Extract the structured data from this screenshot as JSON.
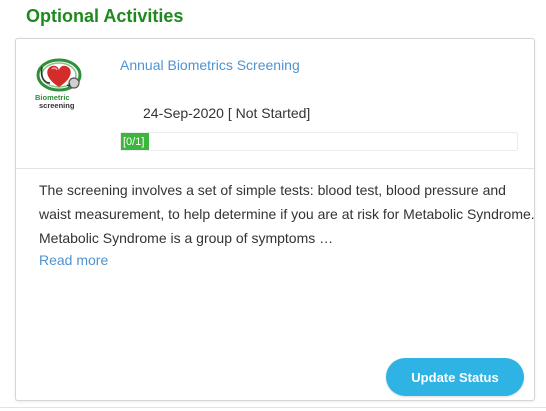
{
  "section": {
    "title": "Optional Activities"
  },
  "activity": {
    "logo_text_line1": "Biometric",
    "logo_text_line2": "screening",
    "title": "Annual Biometrics Screening",
    "date_status": "24-Sep-2020 [ Not Started]",
    "progress_label": "[0/1]",
    "progress_done": 0,
    "progress_total": 1,
    "description": "The screening involves a set of simple tests: blood test, blood pressure and waist measurement, to help determine if you are at risk for Metabolic Syndrome. Metabolic Syndrome is a group of symptoms …",
    "read_more": "Read more",
    "update_button": "Update Status"
  },
  "colors": {
    "title_green": "#1e8a1e",
    "link_blue": "#4f93d1",
    "progress_green": "#3cb53c",
    "button_blue": "#2fb3e4"
  },
  "icons": {
    "logo": "biometric-screening-logo-icon"
  }
}
